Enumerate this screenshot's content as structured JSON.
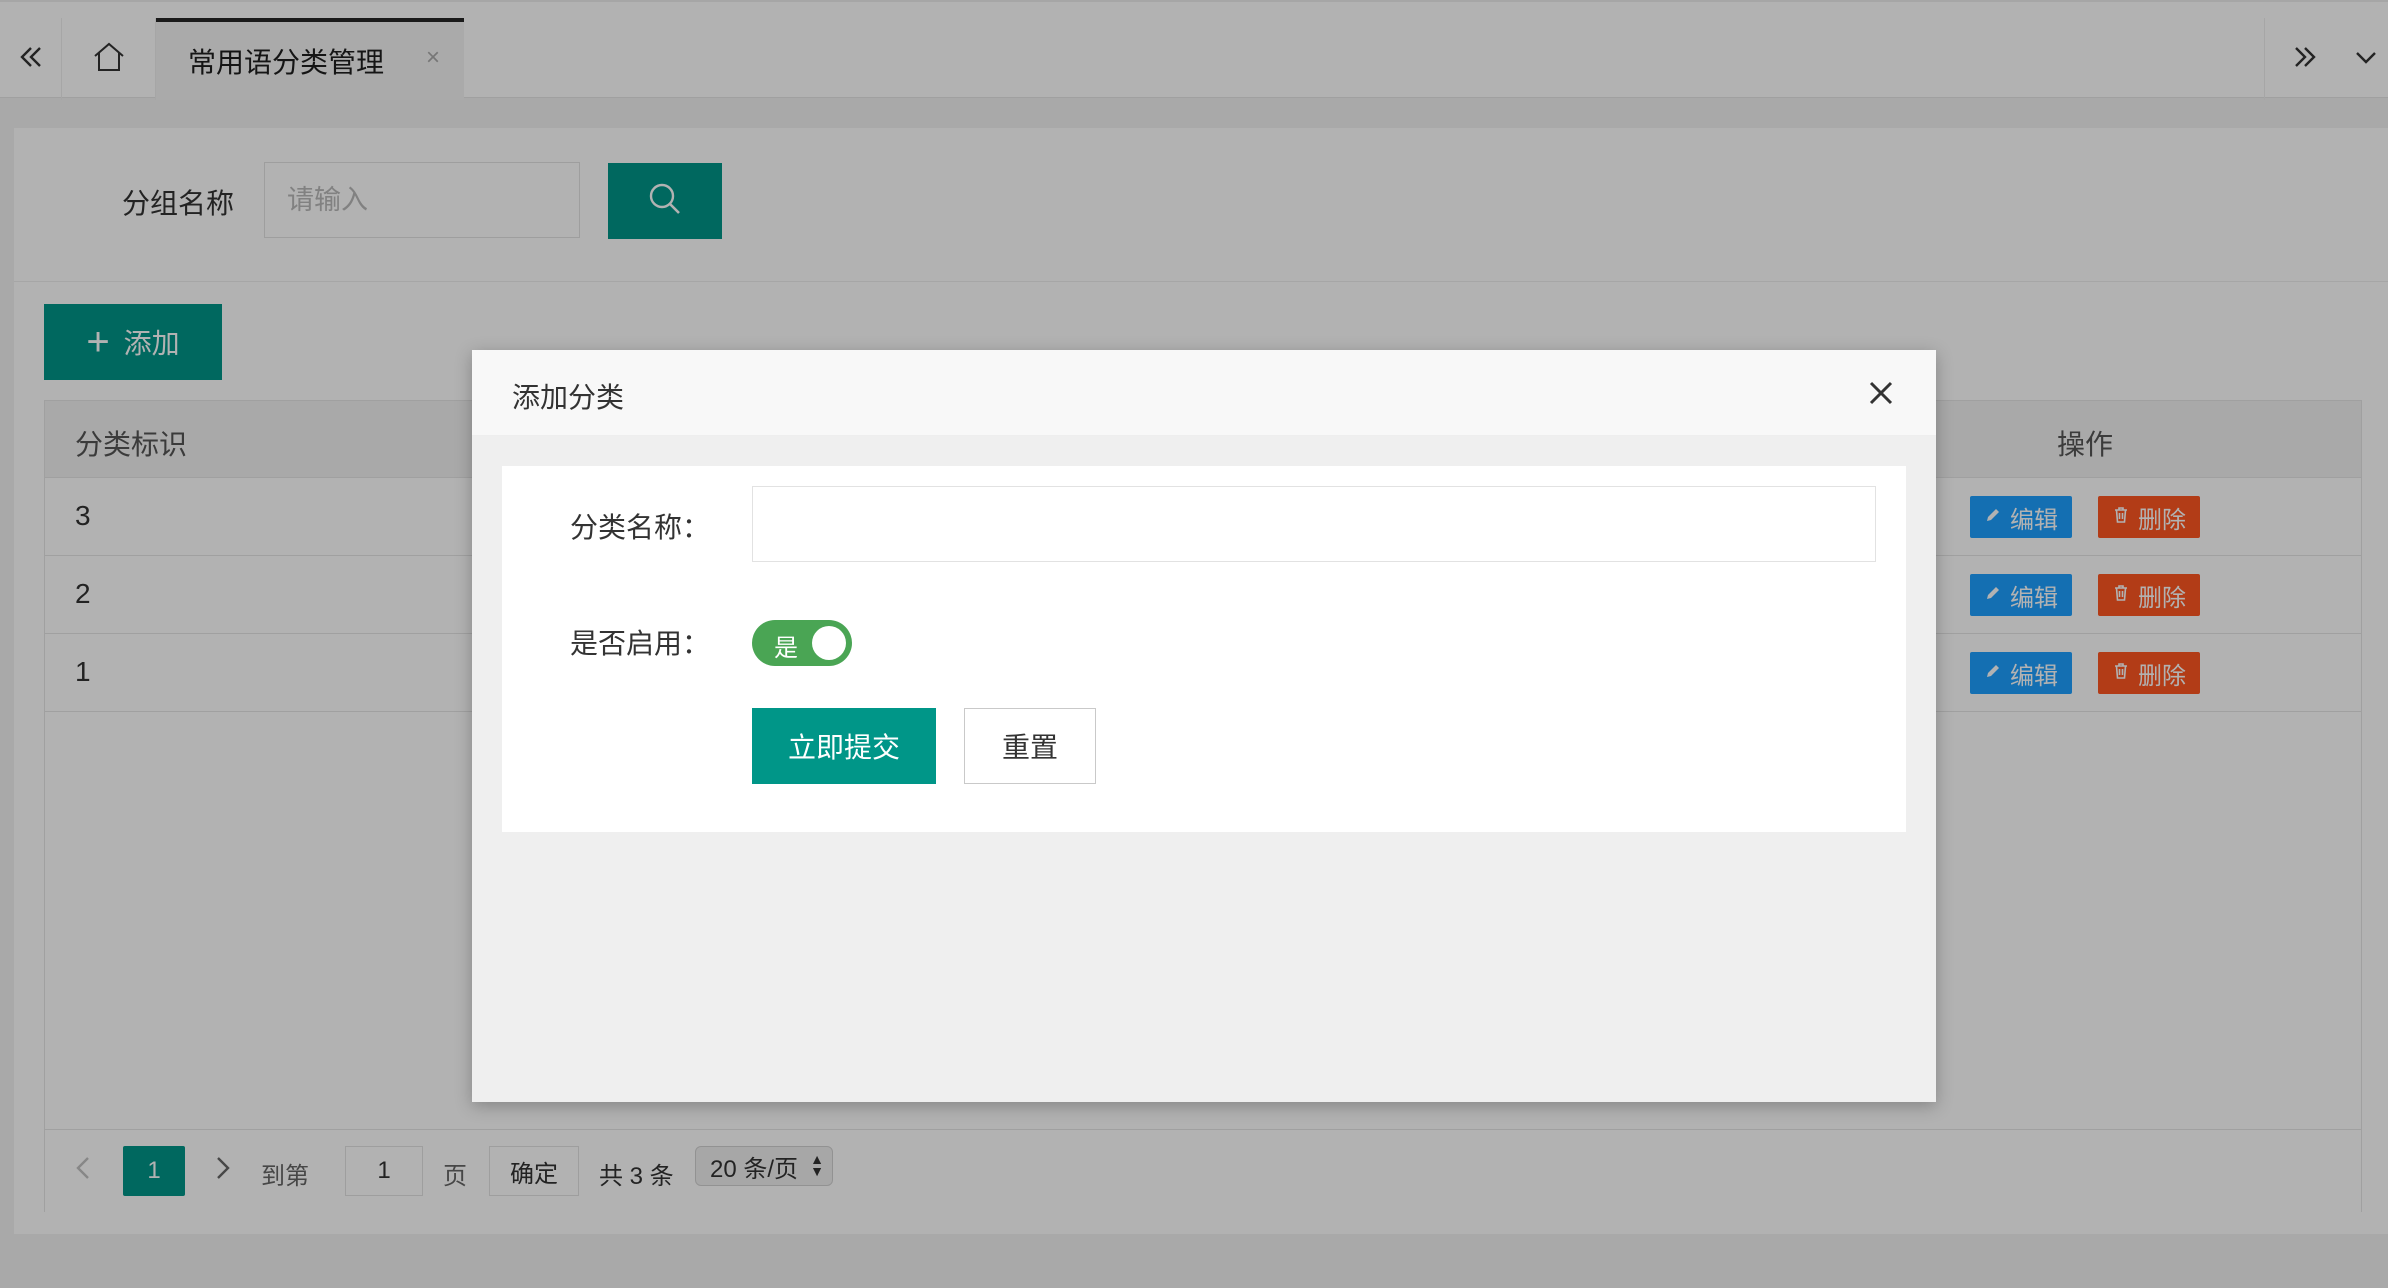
{
  "tabbar": {
    "active_tab_label": "常用语分类管理",
    "tab_close_glyph": "×",
    "icons": [
      "double-chevron-left-icon",
      "home-icon",
      "double-chevron-right-icon",
      "chevron-down-icon"
    ]
  },
  "search": {
    "label": "分组名称",
    "placeholder": "请输入",
    "button_icon": "search-icon"
  },
  "toolbar": {
    "add_label": "添加",
    "add_icon": "plus-icon"
  },
  "table": {
    "columns": {
      "id": "分类标识",
      "actions": "操作"
    },
    "rows": [
      {
        "id": "3"
      },
      {
        "id": "2"
      },
      {
        "id": "1"
      }
    ],
    "edit_label": "编辑",
    "delete_label": "删除"
  },
  "pagination": {
    "current_page": "1",
    "goto_label": "到第",
    "goto_value": "1",
    "page_label": "页",
    "confirm_label": "确定",
    "total_label": "共 3 条",
    "page_size_label": "20 条/页"
  },
  "modal": {
    "title": "添加分类",
    "name_label": "分类名称：",
    "name_value": "",
    "enabled_label": "是否启用：",
    "switch_text": "是",
    "switch_on": true,
    "submit_label": "立即提交",
    "reset_label": "重置"
  },
  "colors": {
    "primary": "#009688",
    "edit": "#1e9fff",
    "delete": "#ff5722",
    "switch_on": "#4aa554"
  }
}
